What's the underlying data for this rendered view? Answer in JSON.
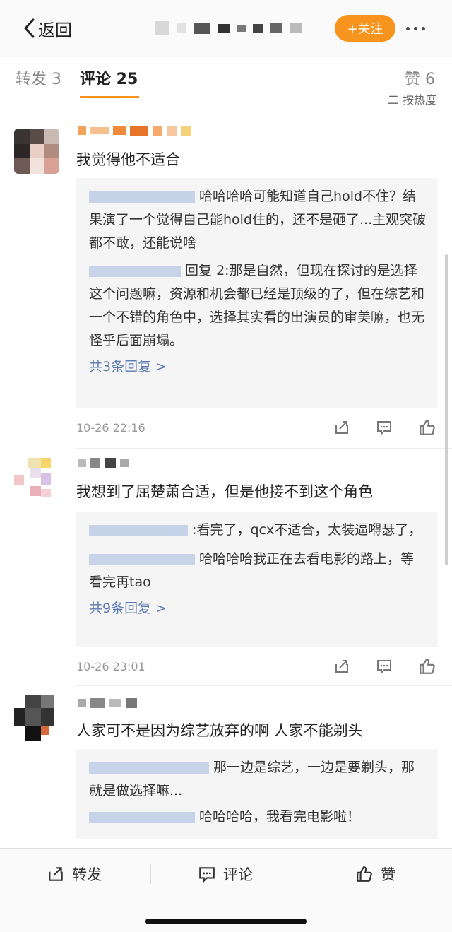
{
  "header": {
    "back_label": "返回",
    "follow_label": "+关注"
  },
  "tabs": {
    "repost": "转发 3",
    "comment": "评论 25",
    "like": "赞 6",
    "sort_fragment": "二 按热度"
  },
  "comments": [
    {
      "text": "我觉得他不适合",
      "replies": [
        "哈哈哈哈可能知道自己hold不住？结果演了一个觉得自己能hold住的，还不是砸了...主观突破都不敢，还能说啥",
        "回复 2:那是自然，但现在探讨的是选择这个问题嘛，资源和机会都已经是顶级的了，但在综艺和一个不错的角色中，选择其实看的出演员的审美嘛，也无怪乎后面崩塌。"
      ],
      "more_replies": "共3条回复 >",
      "time": "10-26 22:16"
    },
    {
      "text": "我想到了屈楚萧合适，但是他接不到这个角色",
      "replies": [
        ":看完了，qcx不适合，太装逼嘚瑟了，",
        "哈哈哈哈我正在去看电影的路上，等看完再tao"
      ],
      "more_replies": "共9条回复 >",
      "time": "10-26 23:01"
    },
    {
      "text": "人家可不是因为综艺放弃的啊 人家不能剃头",
      "replies": [
        "那一边是综艺，一边是要剃头，那就是做选择嘛...",
        "哈哈哈哈，我看完电影啦！"
      ]
    }
  ],
  "bottom_bar": {
    "repost": "转发",
    "comment": "评论",
    "like": "赞"
  },
  "colors": {
    "accent": "#f7941d",
    "link": "#5b7bb0",
    "reply_bg": "#f5f5f5"
  },
  "icons": [
    "chevron-left-icon",
    "more-icon",
    "share-icon",
    "comment-icon",
    "like-icon"
  ]
}
